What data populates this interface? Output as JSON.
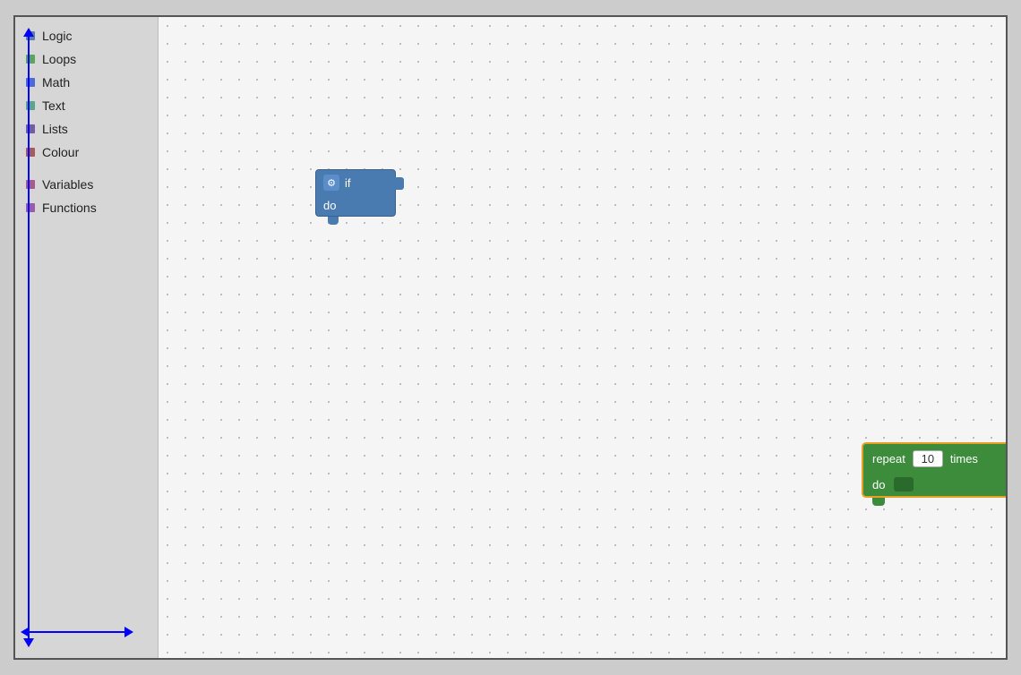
{
  "sidebar": {
    "items": [
      {
        "label": "Logic",
        "color": "#5b80a5"
      },
      {
        "label": "Loops",
        "color": "#5ba55b"
      },
      {
        "label": "Math",
        "color": "#4a6cd4"
      },
      {
        "label": "Text",
        "color": "#5ba58c"
      },
      {
        "label": "Lists",
        "color": "#745ca1"
      },
      {
        "label": "Colour",
        "color": "#a55b5b"
      },
      {
        "label": "Variables",
        "color": "#a55b8c"
      },
      {
        "label": "Functions",
        "color": "#9a5ca6"
      }
    ]
  },
  "if_block": {
    "if_label": "if",
    "do_label": "do",
    "gear_symbol": "⚙"
  },
  "repeat_block": {
    "repeat_label": "repeat",
    "times_label": "times",
    "do_label": "do",
    "count_value": "10"
  },
  "canvas": {
    "background_dot_color": "#aaa"
  }
}
